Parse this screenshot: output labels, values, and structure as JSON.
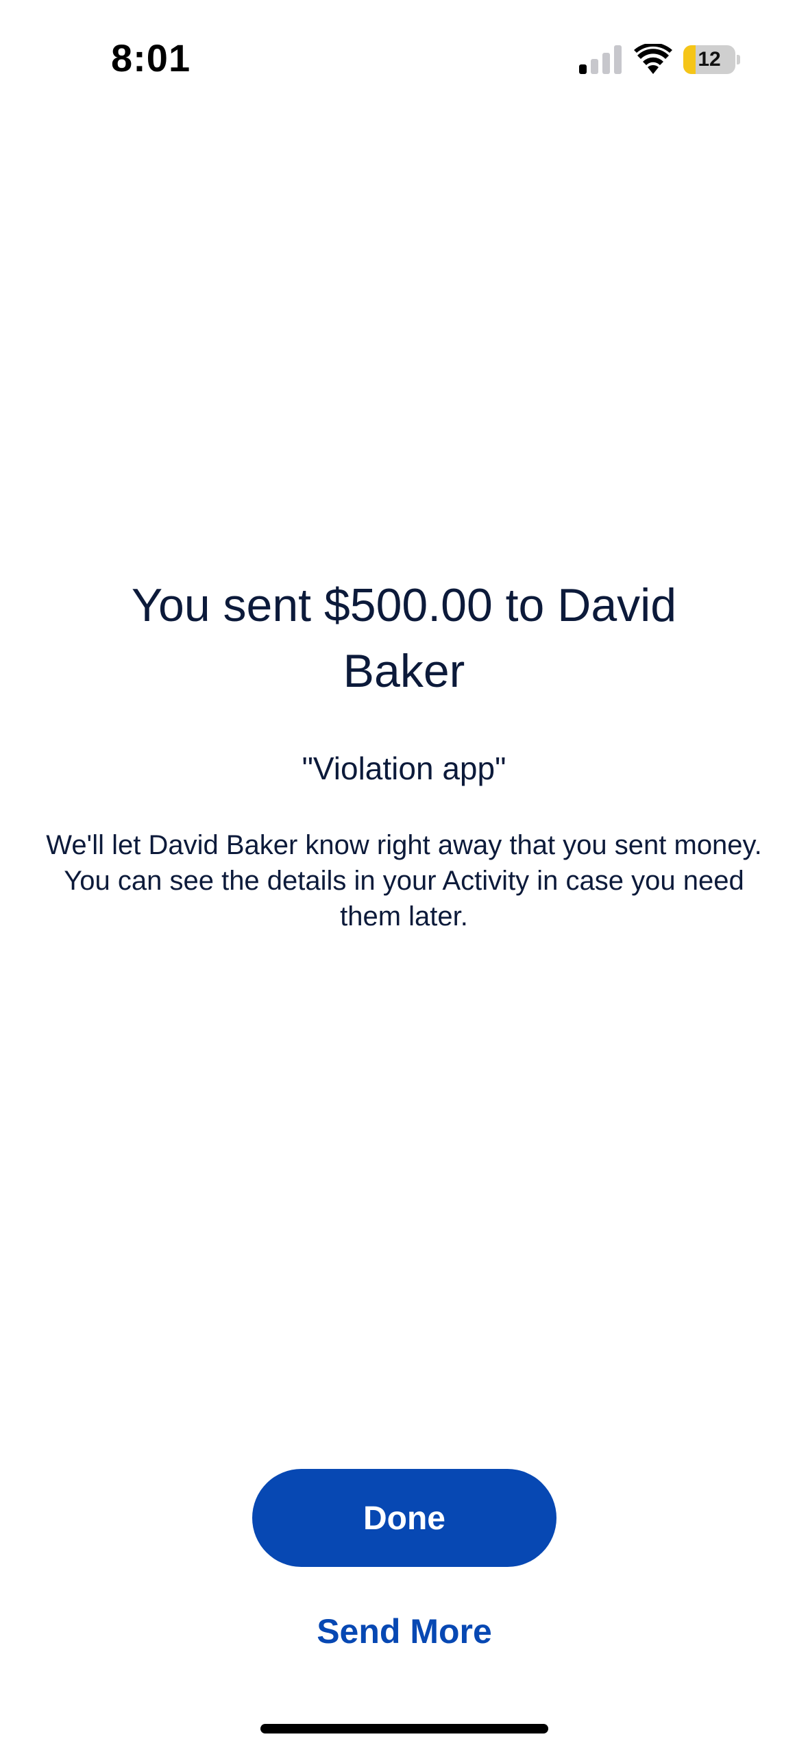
{
  "status_bar": {
    "time": "8:01",
    "battery_level": "12",
    "battery_fraction": 0.12,
    "signal_bars_active": 1,
    "signal_bars_total": 4
  },
  "confirmation": {
    "headline": "You sent $500.00 to David Baker",
    "note": "\"Violation app\"",
    "description": "We'll let David Baker know right away that you sent money. You can see the details in your Activity in case you need them later."
  },
  "actions": {
    "done_label": "Done",
    "send_more_label": "Send More"
  },
  "colors": {
    "primary": "#0748b3",
    "text": "#0c1a3a",
    "battery_low": "#f5c518"
  }
}
